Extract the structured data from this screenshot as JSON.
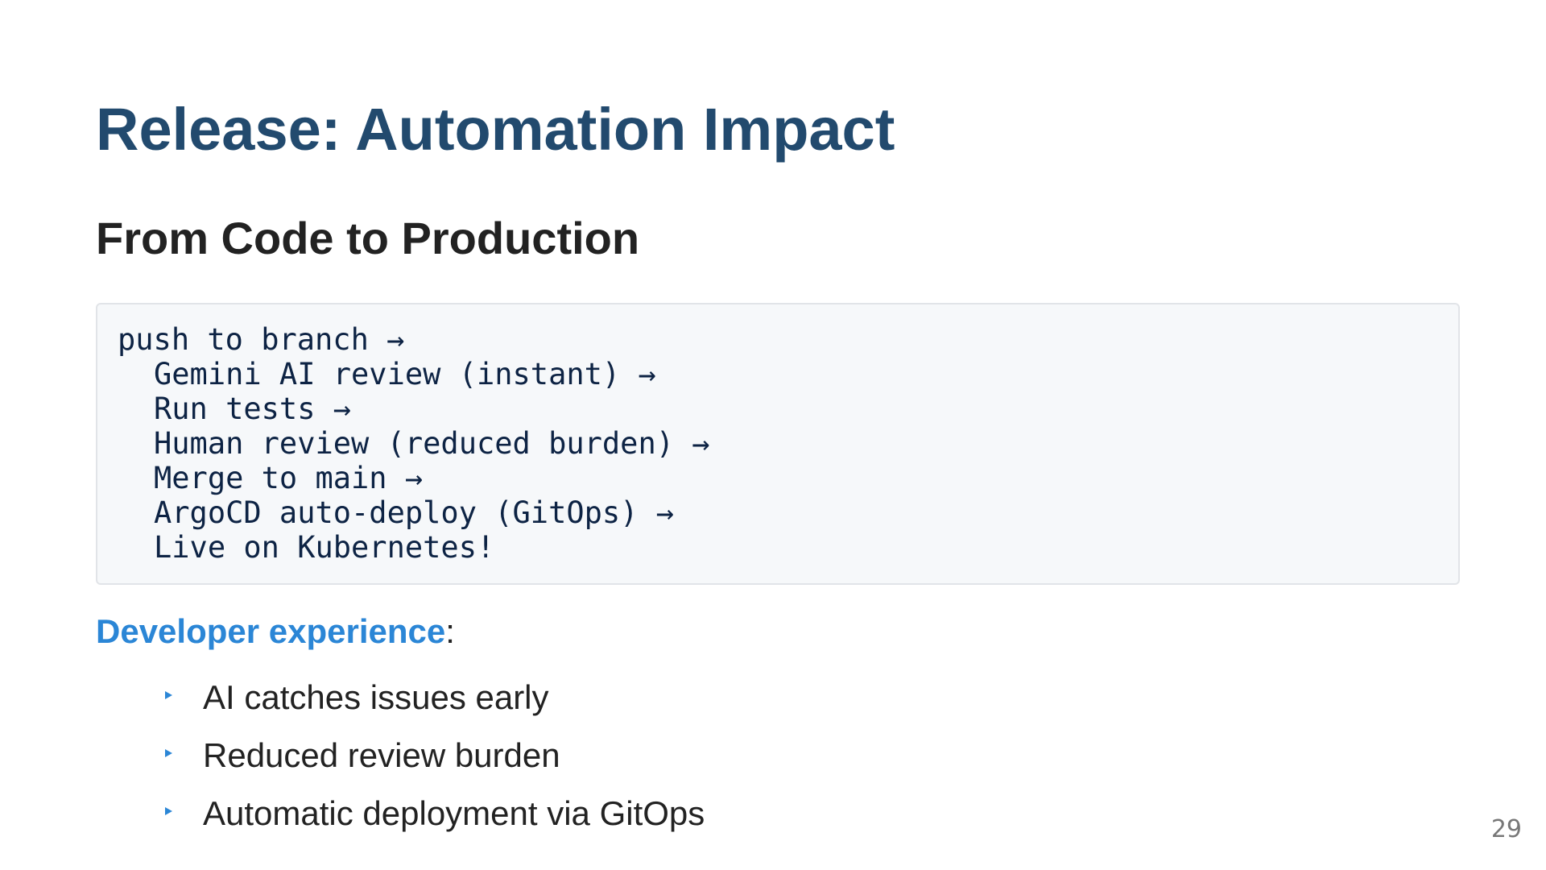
{
  "slide": {
    "title": "Release: Automation Impact",
    "subtitle": "From Code to Production",
    "code_lines": [
      "push to branch →",
      "Gemini AI review (instant) →",
      "Run tests →",
      "Human review (reduced burden) →",
      "Merge to main →",
      "ArgoCD auto-deploy (GitOps) →",
      "Live on Kubernetes!"
    ],
    "developer_heading": "Developer experience",
    "developer_colon": ":",
    "bullets": [
      "AI catches issues early",
      "Reduced review burden",
      "Automatic deployment via GitOps"
    ],
    "page_number": "29"
  },
  "colors": {
    "title": "#224a6e",
    "accent": "#2b86d6",
    "text": "#222222",
    "code_text": "#0d2344",
    "code_background": "#f6f8fa",
    "page_number": "#777777"
  },
  "icons": {
    "bullet": "triangle-bullet-icon"
  }
}
